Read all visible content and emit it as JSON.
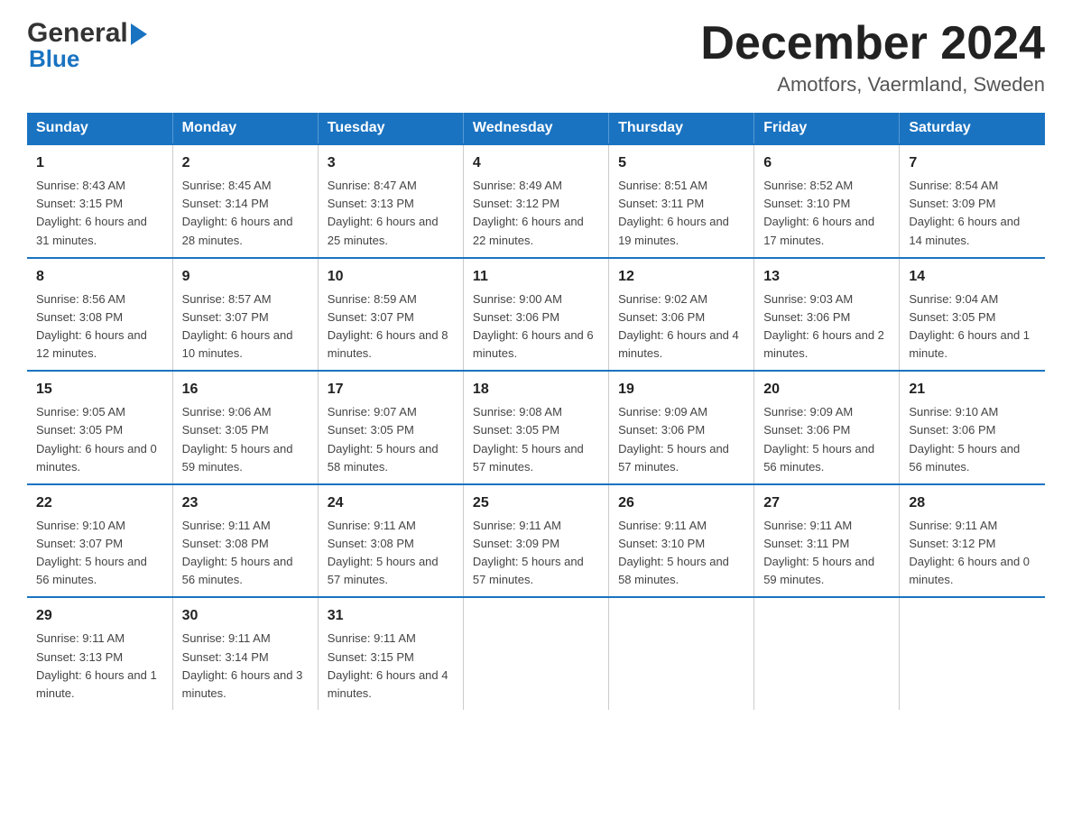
{
  "header": {
    "logo_general": "General",
    "logo_blue": "Blue",
    "month_title": "December 2024",
    "location": "Amotfors, Vaermland, Sweden"
  },
  "days_of_week": [
    "Sunday",
    "Monday",
    "Tuesday",
    "Wednesday",
    "Thursday",
    "Friday",
    "Saturday"
  ],
  "weeks": [
    [
      {
        "day": "1",
        "sunrise": "8:43 AM",
        "sunset": "3:15 PM",
        "daylight": "6 hours and 31 minutes."
      },
      {
        "day": "2",
        "sunrise": "8:45 AM",
        "sunset": "3:14 PM",
        "daylight": "6 hours and 28 minutes."
      },
      {
        "day": "3",
        "sunrise": "8:47 AM",
        "sunset": "3:13 PM",
        "daylight": "6 hours and 25 minutes."
      },
      {
        "day": "4",
        "sunrise": "8:49 AM",
        "sunset": "3:12 PM",
        "daylight": "6 hours and 22 minutes."
      },
      {
        "day": "5",
        "sunrise": "8:51 AM",
        "sunset": "3:11 PM",
        "daylight": "6 hours and 19 minutes."
      },
      {
        "day": "6",
        "sunrise": "8:52 AM",
        "sunset": "3:10 PM",
        "daylight": "6 hours and 17 minutes."
      },
      {
        "day": "7",
        "sunrise": "8:54 AM",
        "sunset": "3:09 PM",
        "daylight": "6 hours and 14 minutes."
      }
    ],
    [
      {
        "day": "8",
        "sunrise": "8:56 AM",
        "sunset": "3:08 PM",
        "daylight": "6 hours and 12 minutes."
      },
      {
        "day": "9",
        "sunrise": "8:57 AM",
        "sunset": "3:07 PM",
        "daylight": "6 hours and 10 minutes."
      },
      {
        "day": "10",
        "sunrise": "8:59 AM",
        "sunset": "3:07 PM",
        "daylight": "6 hours and 8 minutes."
      },
      {
        "day": "11",
        "sunrise": "9:00 AM",
        "sunset": "3:06 PM",
        "daylight": "6 hours and 6 minutes."
      },
      {
        "day": "12",
        "sunrise": "9:02 AM",
        "sunset": "3:06 PM",
        "daylight": "6 hours and 4 minutes."
      },
      {
        "day": "13",
        "sunrise": "9:03 AM",
        "sunset": "3:06 PM",
        "daylight": "6 hours and 2 minutes."
      },
      {
        "day": "14",
        "sunrise": "9:04 AM",
        "sunset": "3:05 PM",
        "daylight": "6 hours and 1 minute."
      }
    ],
    [
      {
        "day": "15",
        "sunrise": "9:05 AM",
        "sunset": "3:05 PM",
        "daylight": "6 hours and 0 minutes."
      },
      {
        "day": "16",
        "sunrise": "9:06 AM",
        "sunset": "3:05 PM",
        "daylight": "5 hours and 59 minutes."
      },
      {
        "day": "17",
        "sunrise": "9:07 AM",
        "sunset": "3:05 PM",
        "daylight": "5 hours and 58 minutes."
      },
      {
        "day": "18",
        "sunrise": "9:08 AM",
        "sunset": "3:05 PM",
        "daylight": "5 hours and 57 minutes."
      },
      {
        "day": "19",
        "sunrise": "9:09 AM",
        "sunset": "3:06 PM",
        "daylight": "5 hours and 57 minutes."
      },
      {
        "day": "20",
        "sunrise": "9:09 AM",
        "sunset": "3:06 PM",
        "daylight": "5 hours and 56 minutes."
      },
      {
        "day": "21",
        "sunrise": "9:10 AM",
        "sunset": "3:06 PM",
        "daylight": "5 hours and 56 minutes."
      }
    ],
    [
      {
        "day": "22",
        "sunrise": "9:10 AM",
        "sunset": "3:07 PM",
        "daylight": "5 hours and 56 minutes."
      },
      {
        "day": "23",
        "sunrise": "9:11 AM",
        "sunset": "3:08 PM",
        "daylight": "5 hours and 56 minutes."
      },
      {
        "day": "24",
        "sunrise": "9:11 AM",
        "sunset": "3:08 PM",
        "daylight": "5 hours and 57 minutes."
      },
      {
        "day": "25",
        "sunrise": "9:11 AM",
        "sunset": "3:09 PM",
        "daylight": "5 hours and 57 minutes."
      },
      {
        "day": "26",
        "sunrise": "9:11 AM",
        "sunset": "3:10 PM",
        "daylight": "5 hours and 58 minutes."
      },
      {
        "day": "27",
        "sunrise": "9:11 AM",
        "sunset": "3:11 PM",
        "daylight": "5 hours and 59 minutes."
      },
      {
        "day": "28",
        "sunrise": "9:11 AM",
        "sunset": "3:12 PM",
        "daylight": "6 hours and 0 minutes."
      }
    ],
    [
      {
        "day": "29",
        "sunrise": "9:11 AM",
        "sunset": "3:13 PM",
        "daylight": "6 hours and 1 minute."
      },
      {
        "day": "30",
        "sunrise": "9:11 AM",
        "sunset": "3:14 PM",
        "daylight": "6 hours and 3 minutes."
      },
      {
        "day": "31",
        "sunrise": "9:11 AM",
        "sunset": "3:15 PM",
        "daylight": "6 hours and 4 minutes."
      },
      null,
      null,
      null,
      null
    ]
  ],
  "labels": {
    "sunrise": "Sunrise:",
    "sunset": "Sunset:",
    "daylight": "Daylight:"
  }
}
